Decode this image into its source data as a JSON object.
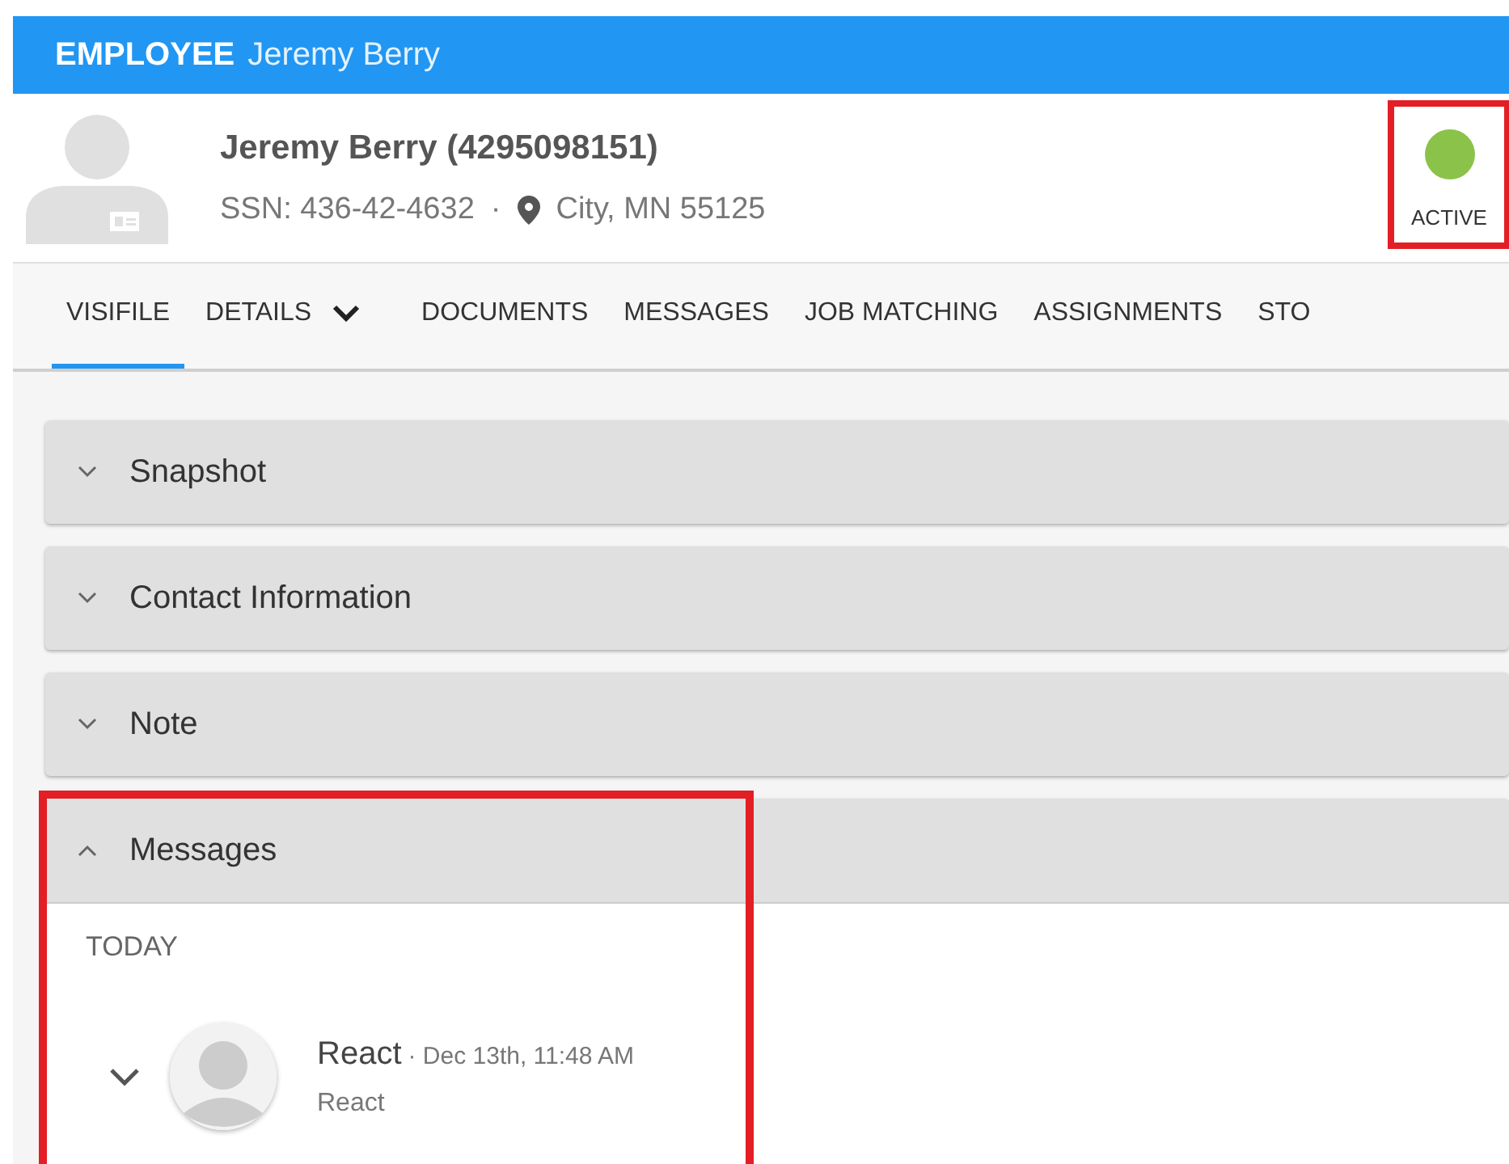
{
  "title_bar": {
    "entity": "EMPLOYEE",
    "name": "Jeremy Berry"
  },
  "profile": {
    "name": "Jeremy Berry (4295098151)",
    "ssn": "SSN: 436-42-4632",
    "separator": "·",
    "location": "City, MN 55125"
  },
  "status": {
    "label": "ACTIVE",
    "color": "#8bc34a"
  },
  "tabs": [
    {
      "label": "VISIFILE",
      "selected": true,
      "kind": "plain"
    },
    {
      "label": "DETAILS",
      "selected": false,
      "kind": "dropdown"
    },
    {
      "label": "DOCUMENTS",
      "selected": false,
      "kind": "plain"
    },
    {
      "label": "MESSAGES",
      "selected": false,
      "kind": "plain"
    },
    {
      "label": "JOB MATCHING",
      "selected": false,
      "kind": "plain"
    },
    {
      "label": "ASSIGNMENTS",
      "selected": false,
      "kind": "plain"
    },
    {
      "label": "STO",
      "selected": false,
      "kind": "plain"
    }
  ],
  "panels": [
    {
      "title": "Snapshot",
      "expanded": false
    },
    {
      "title": "Contact Information",
      "expanded": false
    },
    {
      "title": "Note",
      "expanded": false
    },
    {
      "title": "Messages",
      "expanded": true,
      "groups": [
        {
          "heading": "TODAY",
          "messages": [
            {
              "sender": "React",
              "time": "· Dec 13th, 11:48 AM",
              "body": "React",
              "expanded": false
            }
          ]
        }
      ]
    }
  ]
}
